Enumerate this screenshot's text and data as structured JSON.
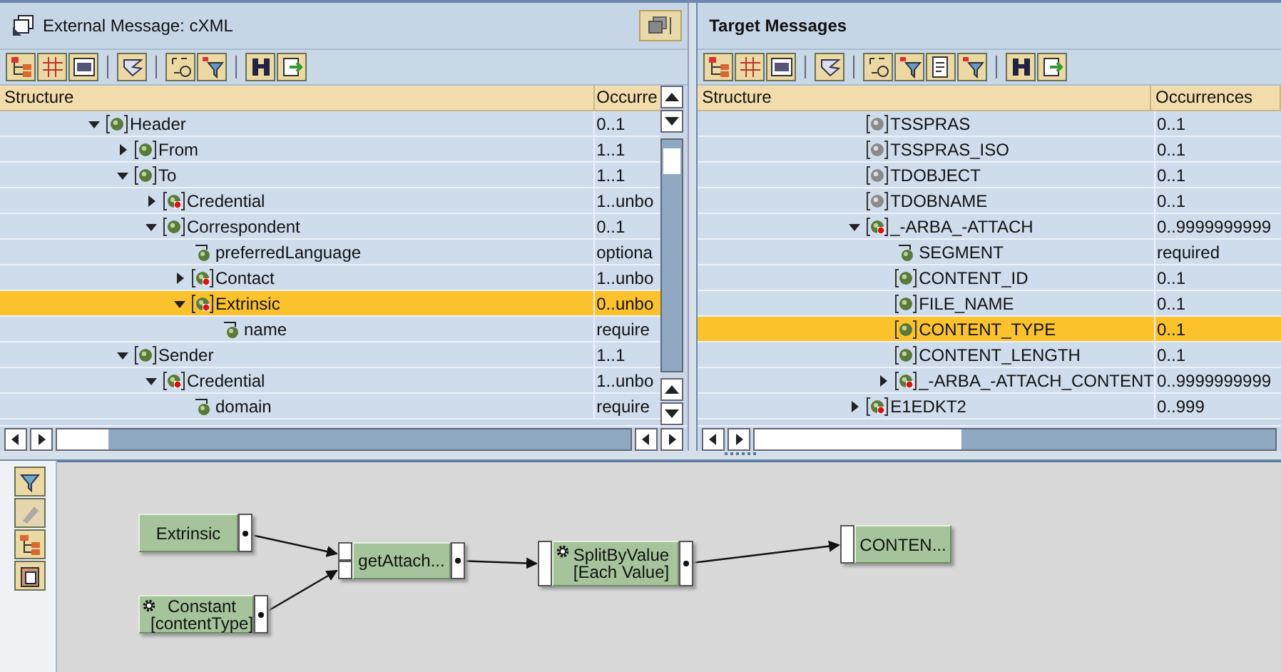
{
  "source": {
    "title": "External Message: cXML",
    "columns": [
      "Structure",
      "Occurre"
    ],
    "rows": [
      {
        "name": "Header",
        "occ": "0..1",
        "kind": "element",
        "expanded": true,
        "selected": false,
        "children": [
          {
            "name": "From",
            "occ": "1..1",
            "kind": "element",
            "expanded": false,
            "selected": false
          },
          {
            "name": "To",
            "occ": "1..1",
            "kind": "element",
            "expanded": true,
            "selected": false,
            "children": [
              {
                "name": "Credential",
                "occ": "1..unbo",
                "kind": "element-flagged",
                "expanded": false,
                "selected": false
              },
              {
                "name": "Correspondent",
                "occ": "0..1",
                "kind": "element",
                "expanded": true,
                "selected": false,
                "children": [
                  {
                    "name": "preferredLanguage",
                    "occ": "optiona",
                    "kind": "attribute",
                    "selected": false
                  },
                  {
                    "name": "Contact",
                    "occ": "1..unbo",
                    "kind": "element-flagged",
                    "expanded": false,
                    "selected": false
                  },
                  {
                    "name": "Extrinsic",
                    "occ": "0..unbo",
                    "kind": "element-flagged",
                    "expanded": true,
                    "selected": true,
                    "children": [
                      {
                        "name": "name",
                        "occ": "require",
                        "kind": "attribute",
                        "selected": false
                      }
                    ]
                  }
                ]
              }
            ]
          },
          {
            "name": "Sender",
            "occ": "1..1",
            "kind": "element",
            "expanded": true,
            "selected": false,
            "children": [
              {
                "name": "Credential",
                "occ": "1..unbo",
                "kind": "element-flagged",
                "expanded": true,
                "selected": false,
                "children": [
                  {
                    "name": "domain",
                    "occ": "require",
                    "kind": "attribute",
                    "selected": false
                  }
                ]
              }
            ]
          }
        ]
      }
    ]
  },
  "target": {
    "title": "Target Messages",
    "columns": [
      "Structure",
      "Occurrences"
    ],
    "rows": [
      {
        "name": "TSSPRAS",
        "occ": "0..1",
        "kind": "grey-element",
        "selected": false
      },
      {
        "name": "TSSPRAS_ISO",
        "occ": "0..1",
        "kind": "grey-element",
        "selected": false
      },
      {
        "name": "TDOBJECT",
        "occ": "0..1",
        "kind": "grey-element",
        "selected": false
      },
      {
        "name": "TDOBNAME",
        "occ": "0..1",
        "kind": "grey-element",
        "selected": false
      },
      {
        "name": "_-ARBA_-ATTACH",
        "occ": "0..9999999999",
        "kind": "element-flagged",
        "expanded": true,
        "selected": false,
        "children": [
          {
            "name": "SEGMENT",
            "occ": "required",
            "kind": "attribute",
            "selected": false
          },
          {
            "name": "CONTENT_ID",
            "occ": "0..1",
            "kind": "element",
            "selected": false
          },
          {
            "name": "FILE_NAME",
            "occ": "0..1",
            "kind": "element",
            "selected": false
          },
          {
            "name": "CONTENT_TYPE",
            "occ": "0..1",
            "kind": "element",
            "selected": true
          },
          {
            "name": "CONTENT_LENGTH",
            "occ": "0..1",
            "kind": "element",
            "selected": false
          },
          {
            "name": "_-ARBA_-ATTACH_CONTENT",
            "occ": "0..9999999999",
            "kind": "element-flagged",
            "expanded": false,
            "selected": false
          }
        ]
      },
      {
        "name": "E1EDKT2",
        "occ": "0..999",
        "kind": "element-flagged",
        "expanded": false,
        "selected": false
      }
    ]
  },
  "mapping": {
    "nodes": [
      {
        "kind": "source",
        "gear": false,
        "lines": [
          "Extrinsic"
        ]
      },
      {
        "kind": "source",
        "gear": true,
        "lines": [
          "Constant",
          "[contentType]"
        ]
      },
      {
        "kind": "function",
        "gear": false,
        "lines": [
          "getAttach..."
        ]
      },
      {
        "kind": "function",
        "gear": true,
        "lines": [
          "SplitByValue",
          "[Each Value]"
        ]
      },
      {
        "kind": "target",
        "gear": false,
        "lines": [
          "CONTEN..."
        ]
      }
    ]
  }
}
